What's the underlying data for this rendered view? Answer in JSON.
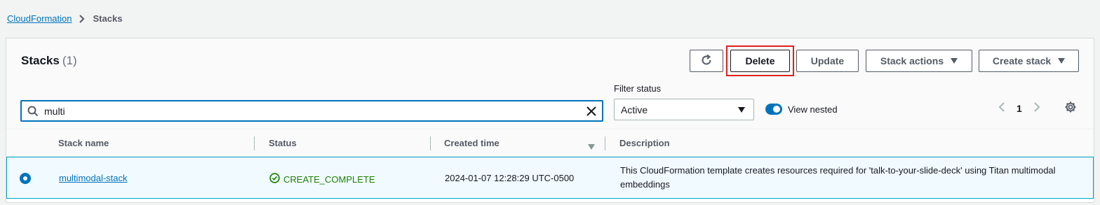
{
  "breadcrumb": {
    "parent": "CloudFormation",
    "current": "Stacks"
  },
  "header": {
    "title": "Stacks",
    "count": "(1)"
  },
  "toolbar": {
    "delete_label": "Delete",
    "update_label": "Update",
    "stack_actions_label": "Stack actions",
    "create_stack_label": "Create stack"
  },
  "filter": {
    "label": "Filter status",
    "selected": "Active",
    "search_value": "multi",
    "view_nested_label": "View nested",
    "view_nested_on": true
  },
  "pagination": {
    "current_page": "1"
  },
  "table": {
    "columns": [
      "Stack name",
      "Status",
      "Created time",
      "Description"
    ],
    "rows": [
      {
        "name": "multimodal-stack",
        "status": "CREATE_COMPLETE",
        "created": "2024-01-07 12:28:29 UTC-0500",
        "description": "This CloudFormation template creates resources required for 'talk-to-your-slide-deck' using Titan multimodal embeddings",
        "selected": true
      }
    ]
  },
  "colors": {
    "accent": "#0073bb",
    "success": "#1d8102",
    "highlight": "#e02020"
  }
}
